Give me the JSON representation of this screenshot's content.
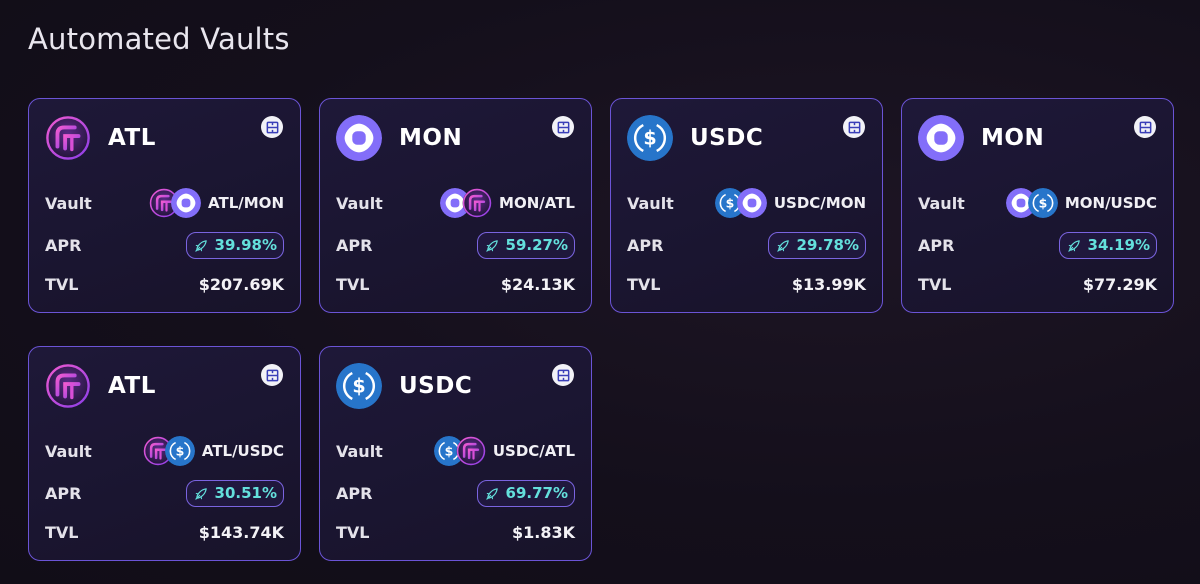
{
  "page": {
    "title": "Automated Vaults"
  },
  "labels": {
    "vault": "Vault",
    "apr": "APR",
    "tvl": "TVL"
  },
  "colors": {
    "card_border": "#6b54d6",
    "apr_text": "#64e0dc",
    "mon_purple": "#836ef9",
    "usdc_blue": "#2775ca",
    "atl_magenta": "#c43bd9"
  },
  "vaults": [
    {
      "token": "ATL",
      "token_icon": "atl-icon",
      "pair": "ATL/MON",
      "pair_icons": [
        "atl-icon",
        "mon-icon"
      ],
      "apr": "39.98%",
      "tvl": "$207.69K"
    },
    {
      "token": "MON",
      "token_icon": "mon-icon",
      "pair": "MON/ATL",
      "pair_icons": [
        "mon-icon",
        "atl-icon"
      ],
      "apr": "59.27%",
      "tvl": "$24.13K"
    },
    {
      "token": "USDC",
      "token_icon": "usdc-icon",
      "pair": "USDC/MON",
      "pair_icons": [
        "usdc-icon",
        "mon-icon"
      ],
      "apr": "29.78%",
      "tvl": "$13.99K"
    },
    {
      "token": "MON",
      "token_icon": "mon-icon",
      "pair": "MON/USDC",
      "pair_icons": [
        "mon-icon",
        "usdc-icon"
      ],
      "apr": "34.19%",
      "tvl": "$77.29K"
    },
    {
      "token": "ATL",
      "token_icon": "atl-icon",
      "pair": "ATL/USDC",
      "pair_icons": [
        "atl-icon",
        "usdc-icon"
      ],
      "apr": "30.51%",
      "tvl": "$143.74K"
    },
    {
      "token": "USDC",
      "token_icon": "usdc-icon",
      "pair": "USDC/ATL",
      "pair_icons": [
        "usdc-icon",
        "atl-icon"
      ],
      "apr": "69.77%",
      "tvl": "$1.83K"
    }
  ]
}
